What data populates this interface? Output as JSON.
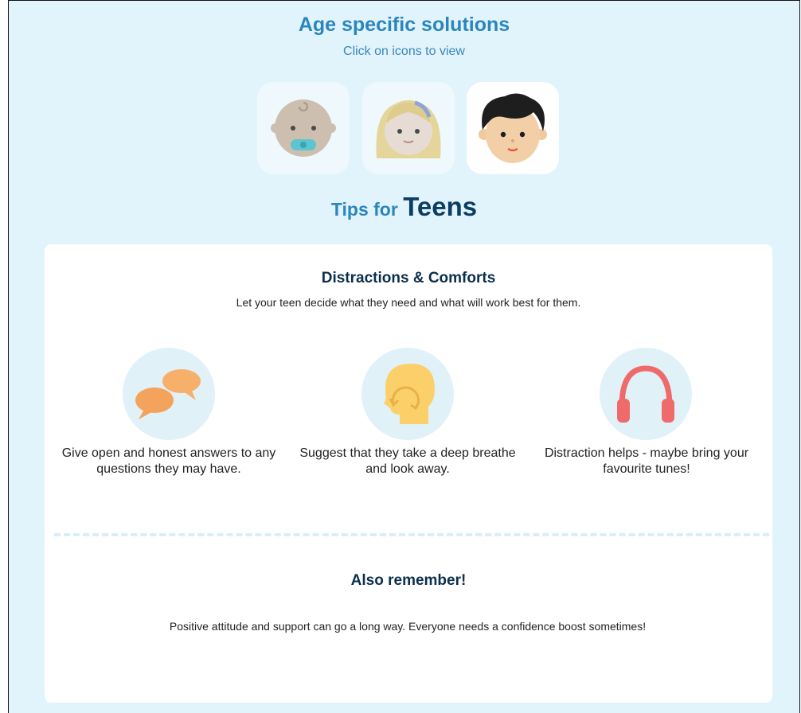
{
  "header": {
    "title": "Age specific solutions",
    "subtitle": "Click on icons to view"
  },
  "age_icons": [
    {
      "name": "baby",
      "selected": false
    },
    {
      "name": "child",
      "selected": false
    },
    {
      "name": "teen",
      "selected": true
    }
  ],
  "tips_heading": {
    "prefix": "Tips for",
    "group": "Teens"
  },
  "card": {
    "title": "Distractions & Comforts",
    "subtitle": "Let your teen decide what they need and what will work best for them.",
    "tips": [
      {
        "icon": "speech-bubbles-icon",
        "text": "Give open and honest answers to any questions they may have."
      },
      {
        "icon": "deep-breath-head-icon",
        "text": "Suggest that they take a deep breathe and look away."
      },
      {
        "icon": "headphones-icon",
        "text": "Distraction helps - maybe bring your favourite tunes!"
      }
    ],
    "also": {
      "title": "Also remember!",
      "text": "Positive attitude and support can go a long way. Everyone needs a confidence boost sometimes!"
    }
  },
  "colors": {
    "background": "#e1f3fb",
    "accent": "#2a86bd",
    "dark_heading": "#0c3d63"
  }
}
